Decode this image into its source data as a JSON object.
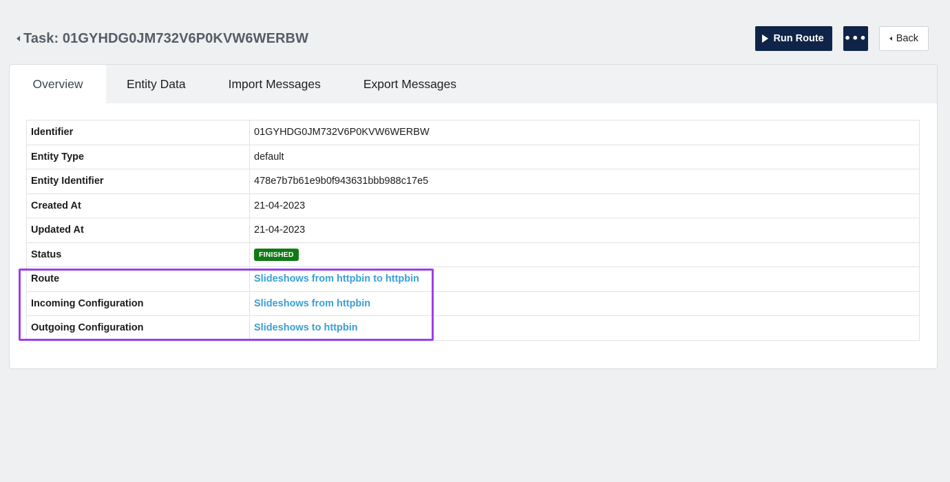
{
  "header": {
    "title": "Task: 01GYHDG0JM732V6P0KVW6WERBW",
    "run_label": "Run Route",
    "more_label": "•••",
    "back_label": "Back"
  },
  "tabs": [
    {
      "label": "Overview",
      "active": true
    },
    {
      "label": "Entity Data",
      "active": false
    },
    {
      "label": "Import Messages",
      "active": false
    },
    {
      "label": "Export Messages",
      "active": false
    }
  ],
  "overview": {
    "rows": [
      {
        "key": "Identifier",
        "value": "01GYHDG0JM732V6P0KVW6WERBW"
      },
      {
        "key": "Entity Type",
        "value": "default"
      },
      {
        "key": "Entity Identifier",
        "value": "478e7b7b61e9b0f943631bbb988c17e5"
      },
      {
        "key": "Created At",
        "value": "21-04-2023"
      },
      {
        "key": "Updated At",
        "value": "21-04-2023"
      },
      {
        "key": "Status",
        "value": "FINISHED"
      },
      {
        "key": "Route",
        "value": "Slideshows from httpbin to httpbin"
      },
      {
        "key": "Incoming Configuration",
        "value": "Slideshows from httpbin"
      },
      {
        "key": "Outgoing Configuration",
        "value": "Slideshows to httpbin"
      }
    ]
  },
  "colors": {
    "primary_button": "#0f2448",
    "status_finished": "#117a16",
    "link": "#3a9fd4",
    "highlight": "#9b3fe8"
  }
}
